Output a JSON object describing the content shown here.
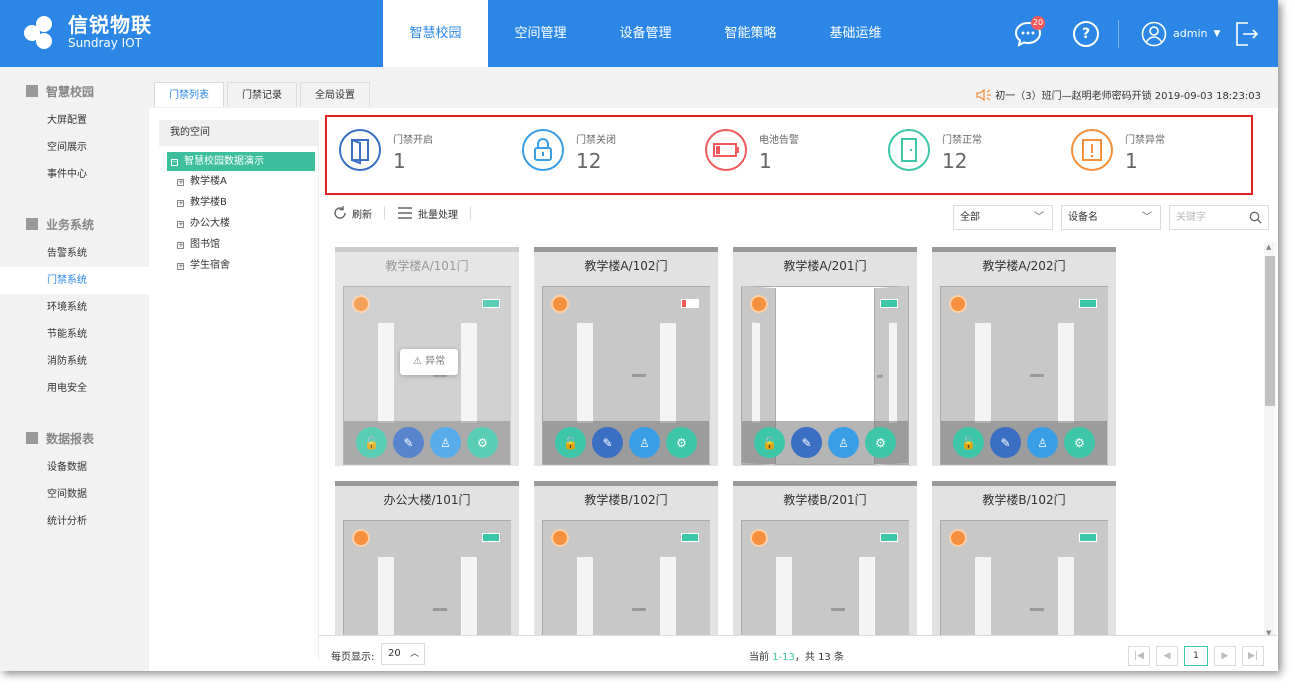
{
  "brand": {
    "name_cn": "信锐物联",
    "name_en": "Sundray IOT"
  },
  "nav": [
    {
      "label": "智慧校园",
      "active": true
    },
    {
      "label": "空间管理"
    },
    {
      "label": "设备管理"
    },
    {
      "label": "智能策略"
    },
    {
      "label": "基础运维"
    }
  ],
  "header": {
    "message_count": "20",
    "help_label": "?",
    "user": "admin"
  },
  "sidebar": {
    "groups": [
      {
        "title": "智慧校园",
        "items": [
          "大屏配置",
          "空间展示",
          "事件中心"
        ]
      },
      {
        "title": "业务系统",
        "items": [
          "告警系统",
          "门禁系统",
          "环境系统",
          "节能系统",
          "消防系统",
          "用电安全"
        ]
      },
      {
        "title": "数据报表",
        "items": [
          "设备数据",
          "空间数据",
          "统计分析"
        ]
      }
    ],
    "active_item": "门禁系统"
  },
  "tabs": [
    "门禁列表",
    "门禁记录",
    "全局设置"
  ],
  "notice": "初一（3）班门—赵明老师密码开锁 2019-09-03 18:23:03",
  "tree": {
    "header": "我的空间",
    "root": "智慧校园数据演示",
    "nodes": [
      "教学楼A",
      "教学楼B",
      "办公大楼",
      "图书馆",
      "学生宿舍"
    ]
  },
  "stats": [
    {
      "label": "门禁开启",
      "value": "1",
      "color": "#3a6fc4"
    },
    {
      "label": "门禁关闭",
      "value": "12",
      "color": "#3a9ee6"
    },
    {
      "label": "电池告警",
      "value": "1",
      "color": "#f05a5a"
    },
    {
      "label": "门禁正常",
      "value": "12",
      "color": "#3dc6a8"
    },
    {
      "label": "门禁异常",
      "value": "1",
      "color": "#f5913e"
    }
  ],
  "toolbar": {
    "refresh": "刷新",
    "batch": "批量处理"
  },
  "filters": {
    "status": "全部",
    "field": "设备名",
    "search_placeholder": "关键字"
  },
  "doors": [
    {
      "name": "教学楼A/101门",
      "state": "abnormal",
      "tip": "异常",
      "battery": "ok"
    },
    {
      "name": "教学楼A/102门",
      "state": "closed",
      "battery": "low"
    },
    {
      "name": "教学楼A/201门",
      "state": "open",
      "battery": "ok"
    },
    {
      "name": "教学楼A/202门",
      "state": "closed",
      "battery": "ok"
    },
    {
      "name": "办公大楼/101门",
      "state": "closed",
      "battery": "ok"
    },
    {
      "name": "教学楼B/102门",
      "state": "closed",
      "battery": "ok"
    },
    {
      "name": "教学楼B/201门",
      "state": "closed",
      "battery": "ok"
    },
    {
      "name": "教学楼B/102门",
      "state": "closed",
      "battery": "ok"
    }
  ],
  "footer": {
    "page_size_label": "每页显示:",
    "page_size": "20",
    "range_prefix": "当前",
    "range": "1-13",
    "total": "，共 13 条",
    "current_page": "1"
  }
}
